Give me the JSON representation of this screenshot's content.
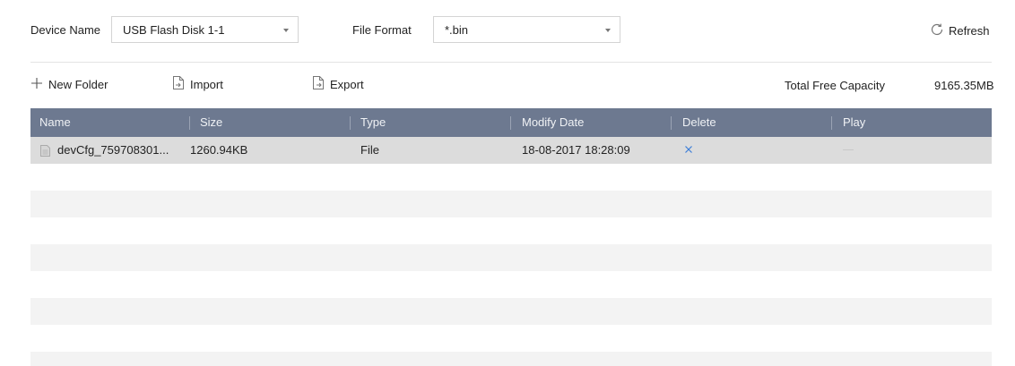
{
  "header": {
    "device_name_label": "Device Name",
    "device_name_value": "USB Flash Disk 1-1",
    "file_format_label": "File Format",
    "file_format_value": "*.bin",
    "refresh_label": "Refresh"
  },
  "toolbar": {
    "new_folder_label": "New Folder",
    "import_label": "Import",
    "export_label": "Export",
    "capacity_label": "Total Free Capacity",
    "capacity_value": "9165.35MB"
  },
  "table": {
    "columns": [
      "Name",
      "Size",
      "Type",
      "Modify Date",
      "Delete",
      "Play"
    ],
    "rows": [
      {
        "name": "devCfg_759708301...",
        "size": "1260.94KB",
        "type": "File",
        "modify_date": "18-08-2017 18:28:09",
        "delete_icon": "close-icon",
        "play": "disabled"
      }
    ]
  },
  "colors": {
    "header_bg": "#6d7990",
    "selected_row": "#dcdcdc",
    "alt_row": "#f3f3f3",
    "delete_accent": "#3b7dd8"
  }
}
